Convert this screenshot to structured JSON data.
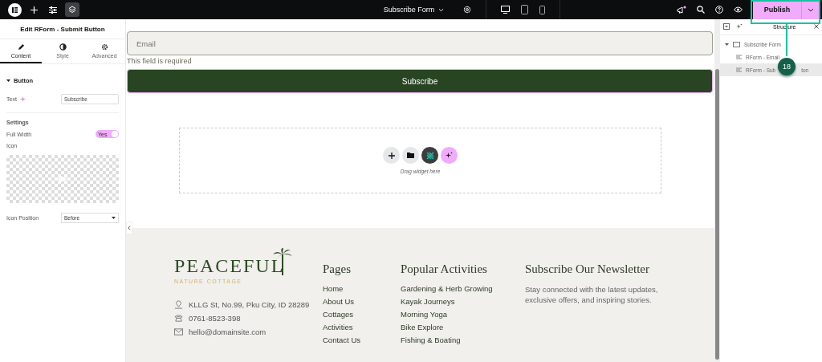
{
  "topbar": {
    "document_title": "Subscribe Form",
    "publish": "Publish"
  },
  "panel": {
    "title": "Edit RForm - Submit Button",
    "tabs": [
      {
        "label": "Content",
        "kind": "pencil",
        "selected": true
      },
      {
        "label": "Style",
        "kind": "contrast",
        "selected": false
      },
      {
        "label": "Advanced",
        "kind": "gear",
        "selected": false
      }
    ],
    "section": {
      "label": "Button",
      "expanded": true
    },
    "text_field": {
      "label": "Text",
      "value": "Subscribe"
    },
    "settings_heading": "Settings",
    "full_width": {
      "label": "Full Width",
      "on": true,
      "toggle_text": "Yes"
    },
    "icon_label": "Icon",
    "icon_position": {
      "label": "Icon Position",
      "value": "Before"
    }
  },
  "canvas": {
    "email_placeholder": "Email",
    "error": "This field is required",
    "button": "Subscribe",
    "drop_hint": "Drag widget here"
  },
  "footer": {
    "logo": "PEACEFUL",
    "tagline": "NATURE COTTAGE",
    "contacts": [
      {
        "kind": "address",
        "text": "KLLG St, No.99, Pku City, ID 28289"
      },
      {
        "kind": "phone",
        "text": "0761-8523-398"
      },
      {
        "kind": "email",
        "text": "hello@domainsite.com"
      }
    ],
    "pages": {
      "title": "Pages",
      "links": [
        "Home",
        "About Us",
        "Cottages",
        "Activities",
        "Contact Us"
      ]
    },
    "activities": {
      "title": "Popular Activities",
      "links": [
        "Gardening & Herb Growing",
        "Kayak Journeys",
        "Morning Yoga",
        "Bike Explore",
        "Fishing & Boating"
      ]
    },
    "newsletter": {
      "title": "Subscribe Our Newsletter",
      "text": "Stay connected with the latest updates, exclusive offers, and inspiring stories."
    }
  },
  "structure": {
    "title": "Structure",
    "items": [
      {
        "label": "Subscribe Form",
        "expanded": true,
        "selected": false,
        "children": [
          {
            "label": "RForm - Email",
            "selected": false
          },
          {
            "label": "RForm - Sub",
            "label_tail": "ton",
            "selected": true
          }
        ]
      }
    ]
  },
  "step_badge": "18"
}
